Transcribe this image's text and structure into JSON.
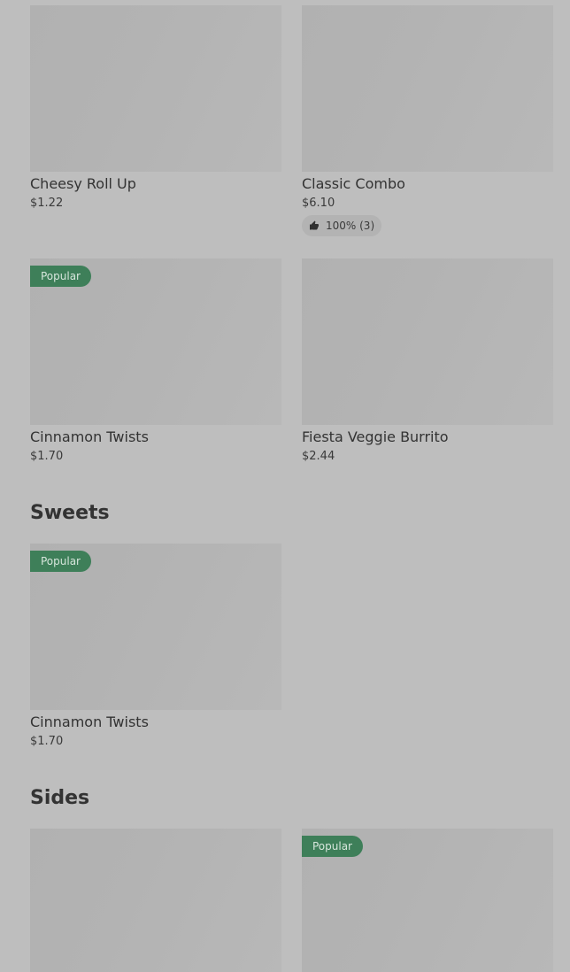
{
  "items": {
    "cheesy_roll_up": {
      "name": "Cheesy Roll Up",
      "price": "$1.22"
    },
    "classic_combo": {
      "name": "Classic Combo",
      "price": "$6.10",
      "rating": "100% (3)"
    },
    "cinnamon_twists_1": {
      "name": "Cinnamon Twists",
      "price": "$1.70",
      "badge": "Popular"
    },
    "fiesta_veggie_burrito": {
      "name": "Fiesta Veggie Burrito",
      "price": "$2.44"
    },
    "cinnamon_twists_2": {
      "name": "Cinnamon Twists",
      "price": "$1.70",
      "badge": "Popular"
    },
    "sides_item_2": {
      "badge": "Popular"
    }
  },
  "sections": {
    "sweets": "Sweets",
    "sides": "Sides"
  },
  "icons": {
    "rating": "thumbs-up-icon"
  },
  "colors": {
    "badge_bg": "#3e7f59",
    "page_bg": "#bebebe"
  }
}
